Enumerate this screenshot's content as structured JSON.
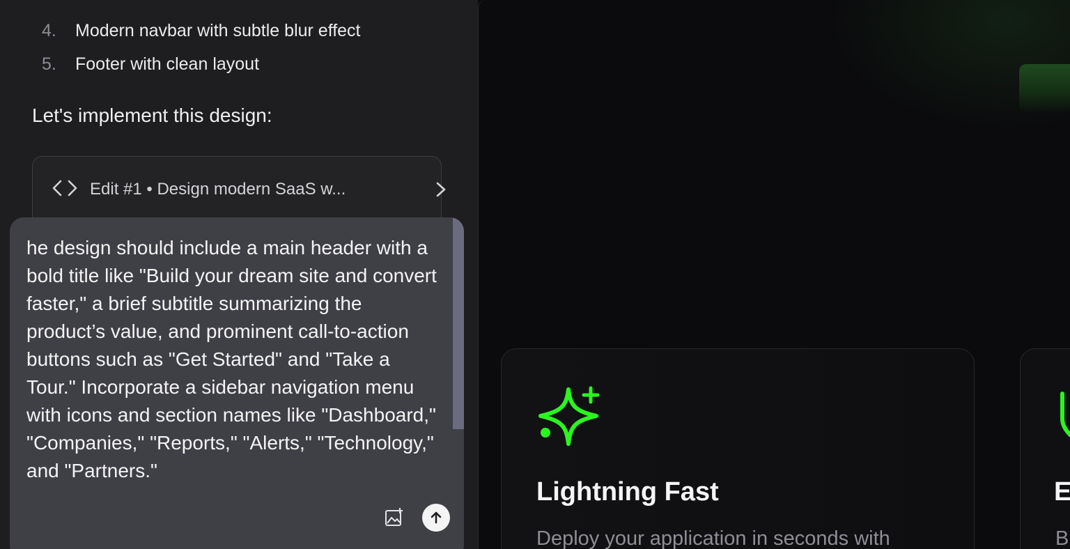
{
  "chat": {
    "steps": [
      {
        "num": "4.",
        "text": "Modern navbar with subtle blur effect"
      },
      {
        "num": "5.",
        "text": "Footer with clean layout"
      }
    ],
    "intro": "Let's implement this design:",
    "edit_card": {
      "label": "Edit #1 • Design modern SaaS w...",
      "icon": "code-icon"
    },
    "composer": {
      "text": "he design should include a main header with a bold title like \"Build your dream site and convert faster,\" a brief subtitle summarizing the product’s value, and prominent call-to-action buttons such as \"Get Started\" and \"Take a Tour.\" Incorporate a sidebar navigation menu with icons and section names like \"Dashboard,\" \"Companies,\" \"Reports,\" \"Alerts,\" \"Technology,\" and \"Partners.\"",
      "image_icon": "image-plus-icon",
      "send_icon": "arrow-up-icon"
    }
  },
  "preview": {
    "accent": "#2af51f",
    "cards": [
      {
        "icon": "sparkle-icon",
        "title": "Lightning Fast",
        "description": "Deploy your application in seconds with"
      },
      {
        "icon": "shield-icon",
        "title": "E",
        "description": "B"
      }
    ]
  }
}
